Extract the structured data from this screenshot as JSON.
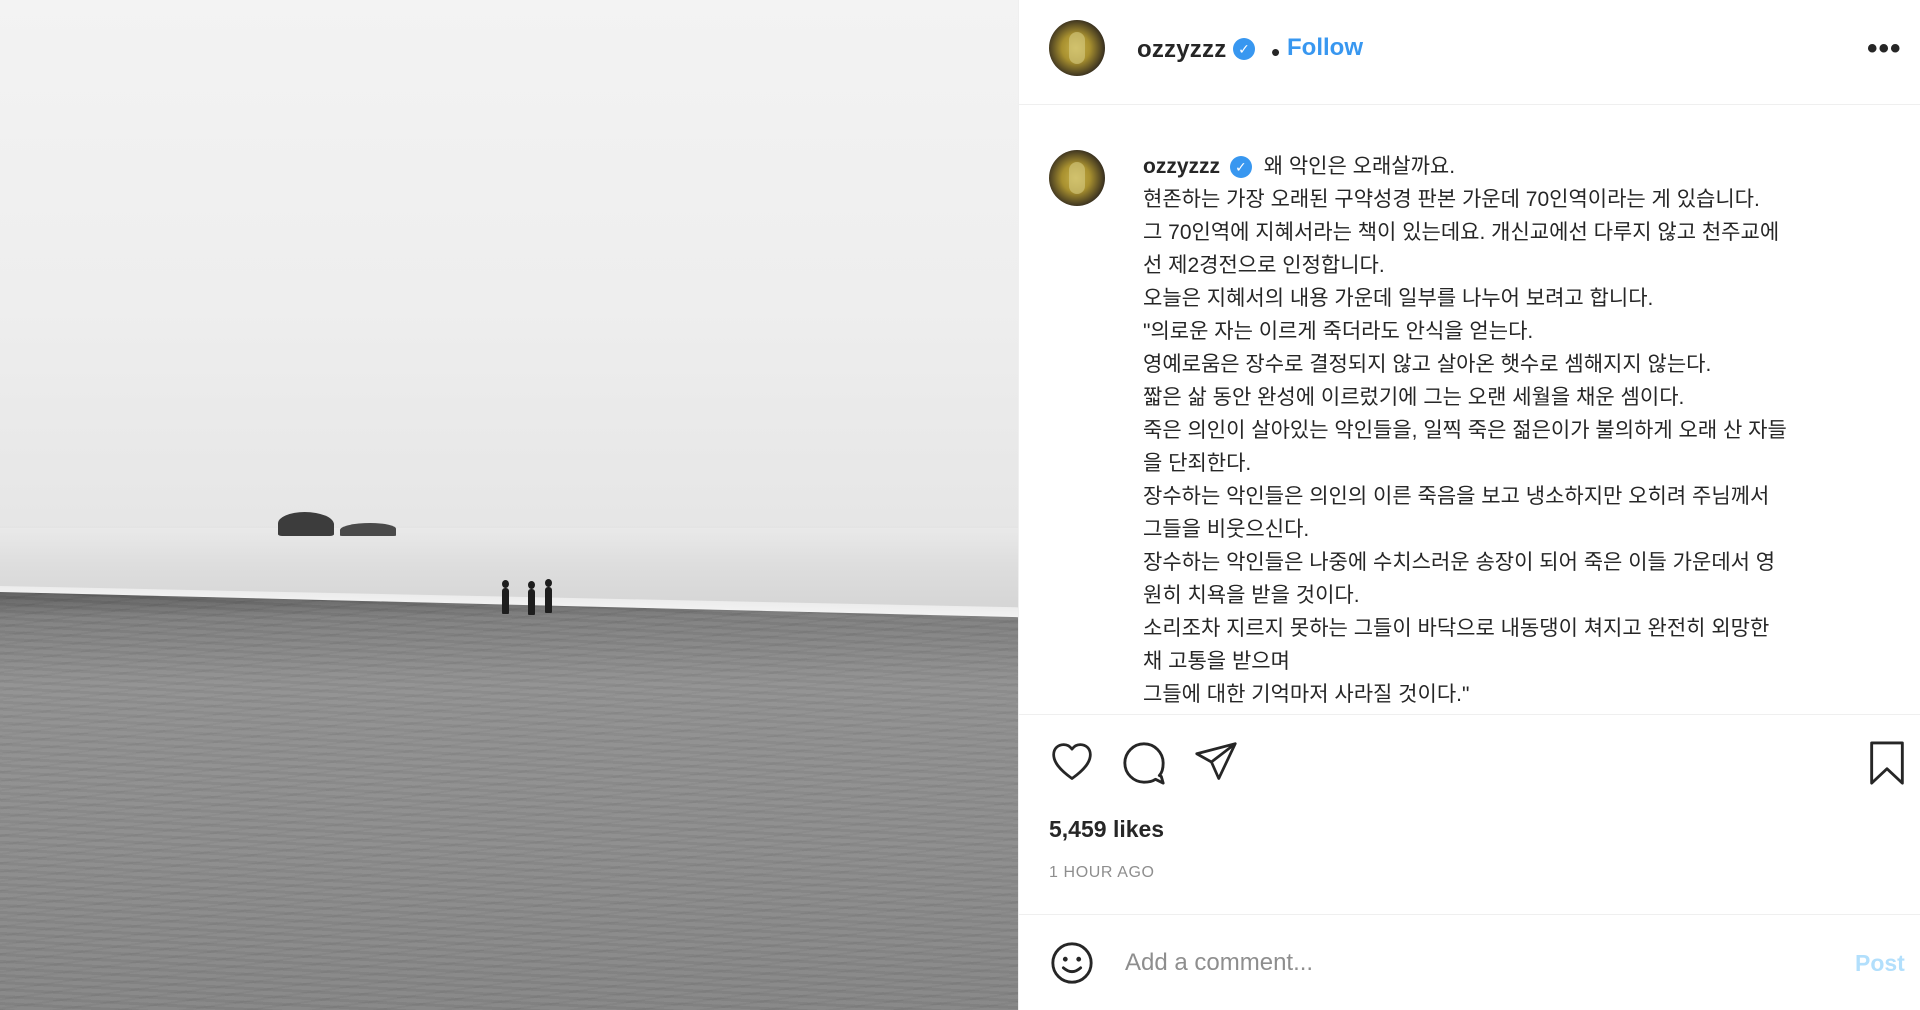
{
  "post": {
    "username": "ozzyzzz",
    "follow_label": "Follow",
    "separator": "•",
    "more_label": "•••",
    "likes": "5,459 likes",
    "timestamp": "1 HOUR AGO"
  },
  "caption": {
    "username": "ozzyzzz",
    "lines": [
      "왜 악인은 오래살까요.",
      "현존하는 가장 오래된 구약성경 판본 가운데 70인역이라는 게 있습니다.",
      "그 70인역에 지혜서라는 책이 있는데요. 개신교에선 다루지 않고 천주교에",
      "선 제2경전으로 인정합니다.",
      "오늘은 지혜서의 내용 가운데 일부를 나누어 보려고 합니다.",
      "\"의로운 자는 이르게 죽더라도 안식을 얻는다.",
      "영예로움은 장수로 결정되지 않고 살아온 햇수로 셈해지지 않는다.",
      "짧은 삶 동안 완성에 이르렀기에 그는 오랜 세월을 채운 셈이다.",
      "죽은 의인이 살아있는 악인들을, 일찍 죽은 젊은이가 불의하게 오래 산 자들",
      "을 단죄한다.",
      "장수하는 악인들은 의인의 이른 죽음을 보고 냉소하지만 오히려 주님께서",
      "그들을 비웃으신다.",
      "장수하는 악인들은 나중에 수치스러운 송장이 되어 죽은 이들 가운데서 영",
      "원히 치욕을 받을 것이다.",
      "소리조차 지르지 못하는 그들이 바닥으로 내동댕이 쳐지고 완전히 외망한",
      "채 고통을 받으며",
      "그들에 대한 기억마저 사라질 것이다.\""
    ]
  },
  "comment": {
    "placeholder": "Add a comment...",
    "post_label": "Post"
  },
  "icons": {
    "like": "heart-icon",
    "comment": "comment-icon",
    "share": "paper-plane-icon",
    "save": "bookmark-icon",
    "emoji": "smiley-icon",
    "verified": "verified-badge-icon"
  },
  "colors": {
    "link_blue": "#3897f0",
    "post_disabled": "#b2dffc",
    "muted_gray": "#8e8e8e",
    "text": "#262626"
  }
}
